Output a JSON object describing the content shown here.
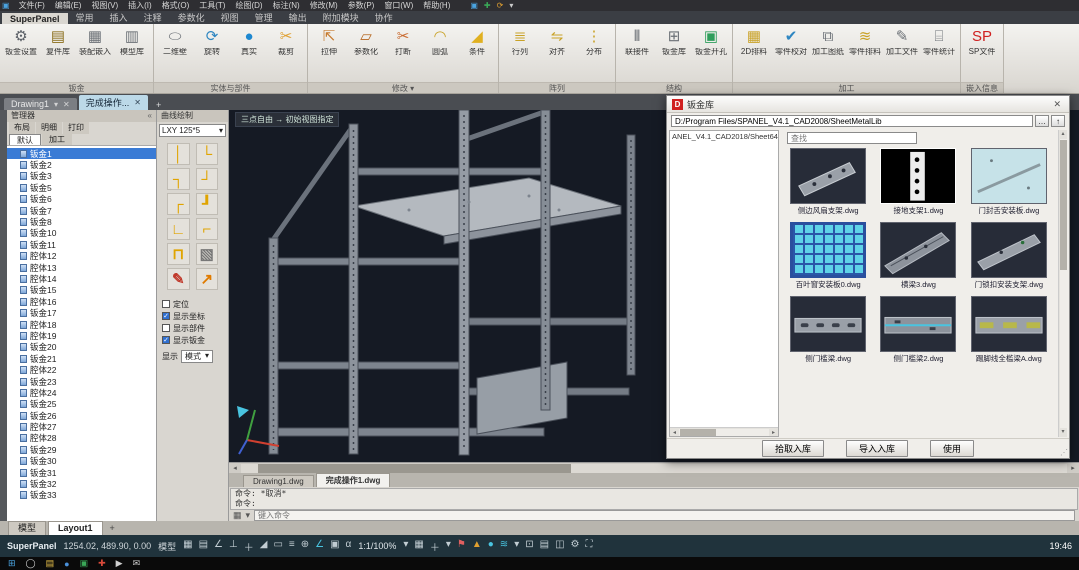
{
  "menubar": {
    "app_icon": "▣",
    "items": [
      "文件(F)",
      "编辑(E)",
      "视图(V)",
      "插入(I)",
      "格式(O)",
      "工具(T)",
      "绘图(D)",
      "标注(N)",
      "修改(M)",
      "参数(P)",
      "窗口(W)",
      "帮助(H)"
    ],
    "quick_icons": [
      {
        "glyph": "▣",
        "color": "#4aa3e0"
      },
      {
        "glyph": "✚",
        "color": "#3aa757"
      },
      {
        "glyph": "⟳",
        "color": "#e0a030"
      },
      {
        "glyph": "▾",
        "color": "#cccccc"
      }
    ]
  },
  "ribbon": {
    "tabs": [
      {
        "label": "SuperPanel",
        "state": "active"
      },
      {
        "label": "常用",
        "state": ""
      },
      {
        "label": "插入",
        "state": ""
      },
      {
        "label": "注释",
        "state": ""
      },
      {
        "label": "参数化",
        "state": ""
      },
      {
        "label": "视图",
        "state": ""
      },
      {
        "label": "管理",
        "state": ""
      },
      {
        "label": "输出",
        "state": ""
      },
      {
        "label": "附加模块",
        "state": ""
      },
      {
        "label": "协作",
        "state": ""
      }
    ],
    "groups": [
      {
        "label": "钣金",
        "items": [
          {
            "label": "钣金设置",
            "glyph": "⚙",
            "color": "#5a5f66"
          },
          {
            "label": "复件库",
            "glyph": "▤",
            "color": "#8a6d1a"
          },
          {
            "label": "装配嵌入",
            "glyph": "▦",
            "color": "#6b7076"
          },
          {
            "label": "模型库",
            "glyph": "▥",
            "color": "#6b7076"
          }
        ]
      },
      {
        "label": "实体与部件",
        "items": [
          {
            "label": "二维壁",
            "glyph": "⬭",
            "color": "#6b7076"
          },
          {
            "label": "旋转",
            "glyph": "⟳",
            "color": "#2e86c1"
          },
          {
            "label": "真实",
            "glyph": "●",
            "color": "#1e88d0"
          },
          {
            "label": "裁剪",
            "glyph": "✂",
            "color": "#e0a030"
          }
        ]
      },
      {
        "label": "修改 ▾",
        "items": [
          {
            "label": "拉伸",
            "glyph": "⇱",
            "color": "#c77b2f"
          },
          {
            "label": "参数化",
            "glyph": "▱",
            "color": "#b5651d"
          },
          {
            "label": "打断",
            "glyph": "✂",
            "color": "#c96a2f"
          },
          {
            "label": "圆弧",
            "glyph": "◠",
            "color": "#c9a227"
          },
          {
            "label": "条件",
            "glyph": "◢",
            "color": "#e0b020"
          }
        ]
      },
      {
        "label": "阵列",
        "items": [
          {
            "label": "行列",
            "glyph": "≣",
            "color": "#c9a227"
          },
          {
            "label": "对齐",
            "glyph": "⇋",
            "color": "#c9a227"
          },
          {
            "label": "分布",
            "glyph": "⋮",
            "color": "#c9a227"
          }
        ]
      },
      {
        "label": "结构",
        "items": [
          {
            "label": "联接件",
            "glyph": "⫴",
            "color": "#5a5f66"
          },
          {
            "label": "钣金库",
            "glyph": "⊞",
            "color": "#6b7076"
          },
          {
            "label": "钣金开孔",
            "glyph": "▣",
            "color": "#2e9e5b"
          }
        ]
      },
      {
        "label": "加工",
        "items": [
          {
            "label": "2D排料",
            "glyph": "▦",
            "color": "#c9a227"
          },
          {
            "label": "零件校对",
            "glyph": "✔",
            "color": "#2e86c1"
          },
          {
            "label": "加工图纸",
            "glyph": "⧉",
            "color": "#6b7076"
          },
          {
            "label": "零件排料",
            "glyph": "≋",
            "color": "#c9a227"
          },
          {
            "label": "加工文件",
            "glyph": "✎",
            "color": "#6b7076"
          },
          {
            "label": "零件统计",
            "glyph": "⌸",
            "color": "#6b7076"
          }
        ]
      },
      {
        "label": "嵌入信息",
        "items": [
          {
            "label": "SP文件",
            "glyph": "SP",
            "color": "#d02020"
          }
        ]
      }
    ]
  },
  "doc_tabs": {
    "tab1": "Drawing1",
    "tab2": "完成操作...",
    "add": "+",
    "close": "✕",
    "drop": "▾"
  },
  "tree": {
    "title": "管理器",
    "collapse_icon": "«",
    "tabs": [
      "布局",
      "明细",
      "打印"
    ],
    "filters": [
      {
        "label": "默认",
        "state": "active"
      },
      {
        "label": "加工",
        "state": ""
      }
    ],
    "items": [
      {
        "label": "钣金1",
        "state": "selected"
      },
      {
        "label": "钣金2",
        "state": ""
      },
      {
        "label": "钣金3",
        "state": ""
      },
      {
        "label": "钣金5",
        "state": ""
      },
      {
        "label": "钣金6",
        "state": ""
      },
      {
        "label": "钣金7",
        "state": ""
      },
      {
        "label": "钣金8",
        "state": ""
      },
      {
        "label": "钣金10",
        "state": ""
      },
      {
        "label": "钣金11",
        "state": ""
      },
      {
        "label": "腔体12",
        "state": ""
      },
      {
        "label": "腔体13",
        "state": ""
      },
      {
        "label": "腔体14",
        "state": ""
      },
      {
        "label": "钣金15",
        "state": ""
      },
      {
        "label": "腔体16",
        "state": ""
      },
      {
        "label": "钣金17",
        "state": ""
      },
      {
        "label": "腔体18",
        "state": ""
      },
      {
        "label": "腔体19",
        "state": ""
      },
      {
        "label": "钣金20",
        "state": ""
      },
      {
        "label": "钣金21",
        "state": ""
      },
      {
        "label": "腔体22",
        "state": ""
      },
      {
        "label": "钣金23",
        "state": ""
      },
      {
        "label": "腔体24",
        "state": ""
      },
      {
        "label": "钣金25",
        "state": ""
      },
      {
        "label": "钣金26",
        "state": ""
      },
      {
        "label": "腔体27",
        "state": ""
      },
      {
        "label": "腔体28",
        "state": ""
      },
      {
        "label": "钣金29",
        "state": ""
      },
      {
        "label": "钣金30",
        "state": ""
      },
      {
        "label": "钣金31",
        "state": ""
      },
      {
        "label": "钣金32",
        "state": ""
      },
      {
        "label": "钣金33",
        "state": ""
      }
    ]
  },
  "palette": {
    "title": "曲线绘制",
    "preset": "LXY 125*5",
    "drop": "▾",
    "bends": [
      {
        "glyph": "│",
        "color": "#e0a400"
      },
      {
        "glyph": "└",
        "color": "#e0a400"
      },
      {
        "glyph": "┐",
        "color": "#e0a400"
      },
      {
        "glyph": "┘",
        "color": "#e0a400"
      },
      {
        "glyph": "┌",
        "color": "#e0a400"
      },
      {
        "glyph": "┚",
        "color": "#e0a400"
      },
      {
        "glyph": "∟",
        "color": "#e0a400"
      },
      {
        "glyph": "⌐",
        "color": "#e0a400"
      },
      {
        "glyph": "⊓",
        "color": "#e0a400"
      },
      {
        "glyph": "▧",
        "color": "#777777"
      },
      {
        "glyph": "✎",
        "color": "#c0392b"
      },
      {
        "glyph": "↗",
        "color": "#e07b00"
      }
    ],
    "options": [
      {
        "label": "定位",
        "state": ""
      },
      {
        "label": "显示坐标",
        "state": "checked"
      },
      {
        "label": "显示部件",
        "state": ""
      },
      {
        "label": "显示钣金",
        "state": "checked"
      }
    ],
    "display_label": "显示",
    "display_value": "模式"
  },
  "viewport": {
    "hint": "三点自由 → 初始视图指定"
  },
  "file_tabs": {
    "tab1": "Drawing1.dwg",
    "tab2": "完成操作1.dwg"
  },
  "command": {
    "line1": "命令: *取消*",
    "line2": "命令:",
    "placeholder": "键入命令",
    "icon": "▦",
    "drop": "▾"
  },
  "dialog": {
    "title": "钣金库",
    "logo": "D",
    "close": "✕",
    "path": "D:/Program Files/SPANEL_V4.1_CAD2008/SheetMetalLib",
    "btn_browse": "…",
    "btn_up": "↑",
    "left_header": "ANEL_V4.1_CAD2018/Sheet64",
    "search_placeholder": "查找",
    "items": [
      {
        "caption": "侧边风扇支架.dwg"
      },
      {
        "caption": "接地支架1.dwg"
      },
      {
        "caption": "门封舌安装板.dwg"
      },
      {
        "caption": "百叶窗安装板0.dwg"
      },
      {
        "caption": "横梁3.dwg"
      },
      {
        "caption": "门锁扣安装支架.dwg"
      },
      {
        "caption": "侧门槛梁.dwg"
      },
      {
        "caption": "侧门槛梁2.dwg"
      },
      {
        "caption": "踢脚线全槛梁A.dwg"
      }
    ],
    "buttons": {
      "b1": "拾取入库",
      "b2": "导入入库",
      "b3": "使用"
    }
  },
  "layout_tabs": {
    "model": "模型",
    "layout1": "Layout1",
    "add": "+"
  },
  "status": {
    "app": "SuperPanel",
    "coords": "1254.02, 489.90, 0.00",
    "mode": "模型",
    "zoom": "1:1/100%",
    "clock": "19:46",
    "mid_icons": [
      {
        "glyph": "▦"
      },
      {
        "glyph": "▤"
      },
      {
        "glyph": "∠"
      },
      {
        "glyph": "⊥"
      },
      {
        "glyph": "＋"
      },
      {
        "glyph": "◢"
      },
      {
        "glyph": "▭"
      },
      {
        "glyph": "≡"
      },
      {
        "glyph": "⊕"
      },
      {
        "glyph": "∠",
        "color": "#49c4e0"
      },
      {
        "glyph": "▣"
      },
      {
        "glyph": "α"
      }
    ],
    "right_icons": [
      {
        "glyph": "▾"
      },
      {
        "glyph": "▦"
      },
      {
        "glyph": "＋"
      },
      {
        "glyph": "▾"
      },
      {
        "glyph": "⚑",
        "color": "#e06060"
      },
      {
        "glyph": "▲",
        "color": "#e0a030"
      },
      {
        "glyph": "●",
        "color": "#49c4e0"
      },
      {
        "glyph": "≋",
        "color": "#49c4e0"
      },
      {
        "glyph": "▾"
      },
      {
        "glyph": "⊡"
      },
      {
        "glyph": "▤"
      },
      {
        "glyph": "◫"
      },
      {
        "glyph": "⚙"
      },
      {
        "glyph": "⛶"
      }
    ]
  },
  "taskbar": {
    "icons": [
      {
        "glyph": "⊞",
        "color": "#4aa3e0"
      },
      {
        "glyph": "◯",
        "color": "#cfcfcf"
      },
      {
        "glyph": "▤",
        "color": "#e8c14a"
      },
      {
        "glyph": "●",
        "color": "#4a90d9"
      },
      {
        "glyph": "▣",
        "color": "#3aa757"
      },
      {
        "glyph": "✚",
        "color": "#d94a3a"
      },
      {
        "glyph": "▶",
        "color": "#cfcfcf"
      },
      {
        "glyph": "✉",
        "color": "#cfcfcf"
      }
    ]
  }
}
